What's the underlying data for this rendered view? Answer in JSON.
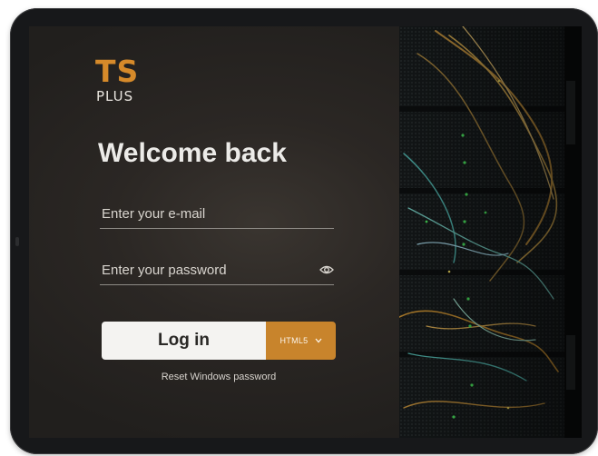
{
  "brand": {
    "logo_main": "TS",
    "logo_sub": "PLUS",
    "accent_color": "#c8842c"
  },
  "login": {
    "heading": "Welcome back",
    "email_placeholder": "Enter your e-mail",
    "password_placeholder": "Enter your password",
    "login_button": "Log in",
    "mode_selected": "HTML5",
    "reset_link": "Reset Windows password"
  },
  "icons": {
    "password_toggle": "eye-icon",
    "mode_dropdown": "chevron-down-icon"
  }
}
